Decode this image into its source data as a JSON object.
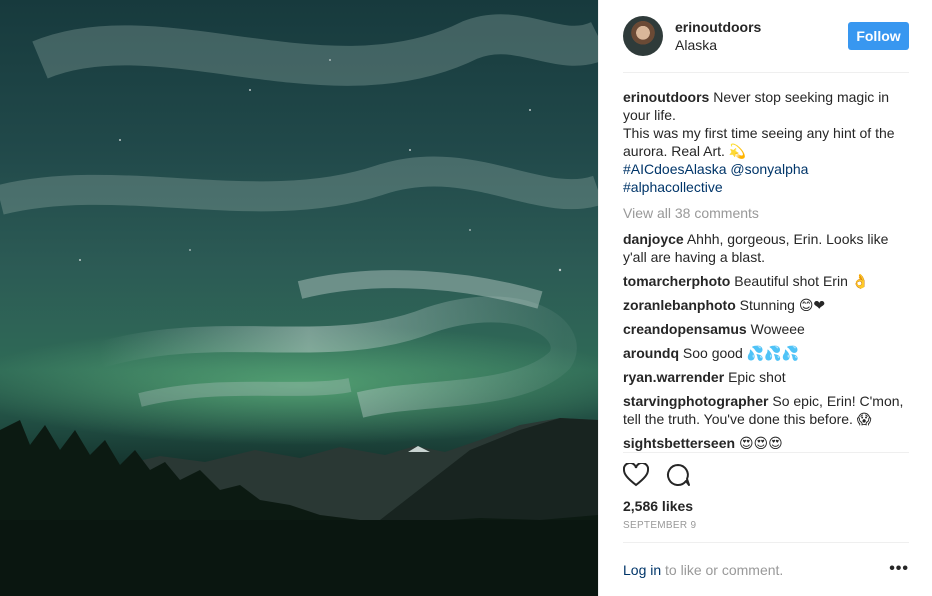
{
  "post": {
    "author": "erinoutdoors",
    "location": "Alaska",
    "follow_label": "Follow",
    "caption": {
      "user": "erinoutdoors",
      "line1": "Never stop seeking magic in",
      "line2": "your life.",
      "line3": "This was my first time seeing any hint of the",
      "line4": "aurora. Real Art. 💫",
      "tags1": "#AICdoesAlaska @sonyalpha",
      "tags2": "#alphacollective"
    },
    "view_all": "View all 38 comments",
    "comments": [
      {
        "user": "danjoyce",
        "text": "Ahhh, gorgeous, Erin. Looks like",
        "text2": "y'all are having a blast."
      },
      {
        "user": "tomarcherphoto",
        "text": "Beautiful shot Erin 👌",
        "text2": ""
      },
      {
        "user": "zoranlebanphoto",
        "text": "Stunning 😊❤",
        "text2": ""
      },
      {
        "user": "creandopensamus",
        "text": "Woweee",
        "text2": ""
      },
      {
        "user": "aroundq",
        "text": "Soo good 💦💦💦",
        "text2": ""
      },
      {
        "user": "ryan.warrender",
        "text": "Epic shot",
        "text2": ""
      },
      {
        "user": "starvingphotographer",
        "text": "So epic, Erin! C'mon,",
        "text2": "tell the truth. You've done this before. 😱"
      },
      {
        "user": "sightsbetterseen",
        "text": "😍😍😍",
        "text2": ""
      }
    ],
    "likes": "2,586 likes",
    "date": "SEPTEMBER 9",
    "login_link": "Log in",
    "login_rest": " to like or comment.",
    "more": "•••"
  },
  "icons": {
    "like": "heart-icon",
    "comment": "comment-icon",
    "more": "more-options-icon"
  }
}
